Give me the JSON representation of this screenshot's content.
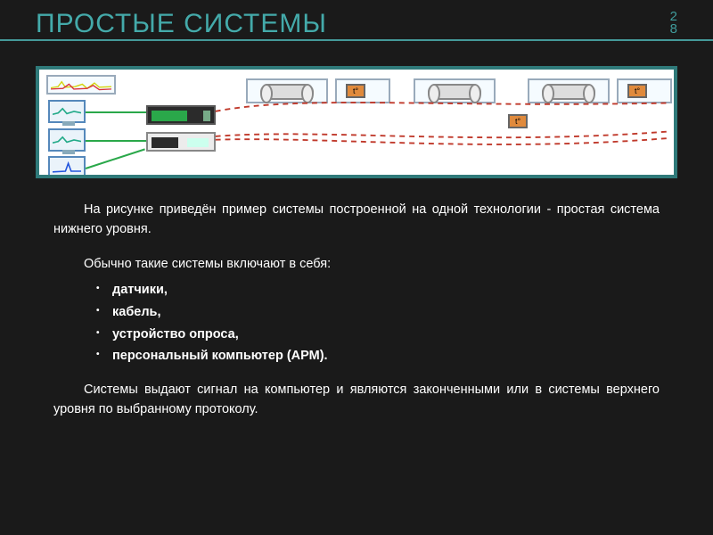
{
  "page_number_top": "2",
  "page_number_bottom": "8",
  "title": "ПРОСТЫЕ СИСТЕМЫ",
  "para1": "На рисунке приведён пример системы построенной на одной технологии - простая система нижнего уровня.",
  "lead": "Обычно такие системы  включают в себя:",
  "items": [
    "датчики,",
    "кабель,",
    "устройство опроса,",
    "персональный компьютер (АРМ)."
  ],
  "para2": "Системы выдают сигнал на компьютер и являются законченными или в системы верхнего уровня по выбранному протоколу.",
  "diagram": {
    "sensor_label": "t°",
    "colors": {
      "accent": "#2f7a7a",
      "wire": "#c0392b",
      "sensor": "#e08a3c"
    }
  }
}
